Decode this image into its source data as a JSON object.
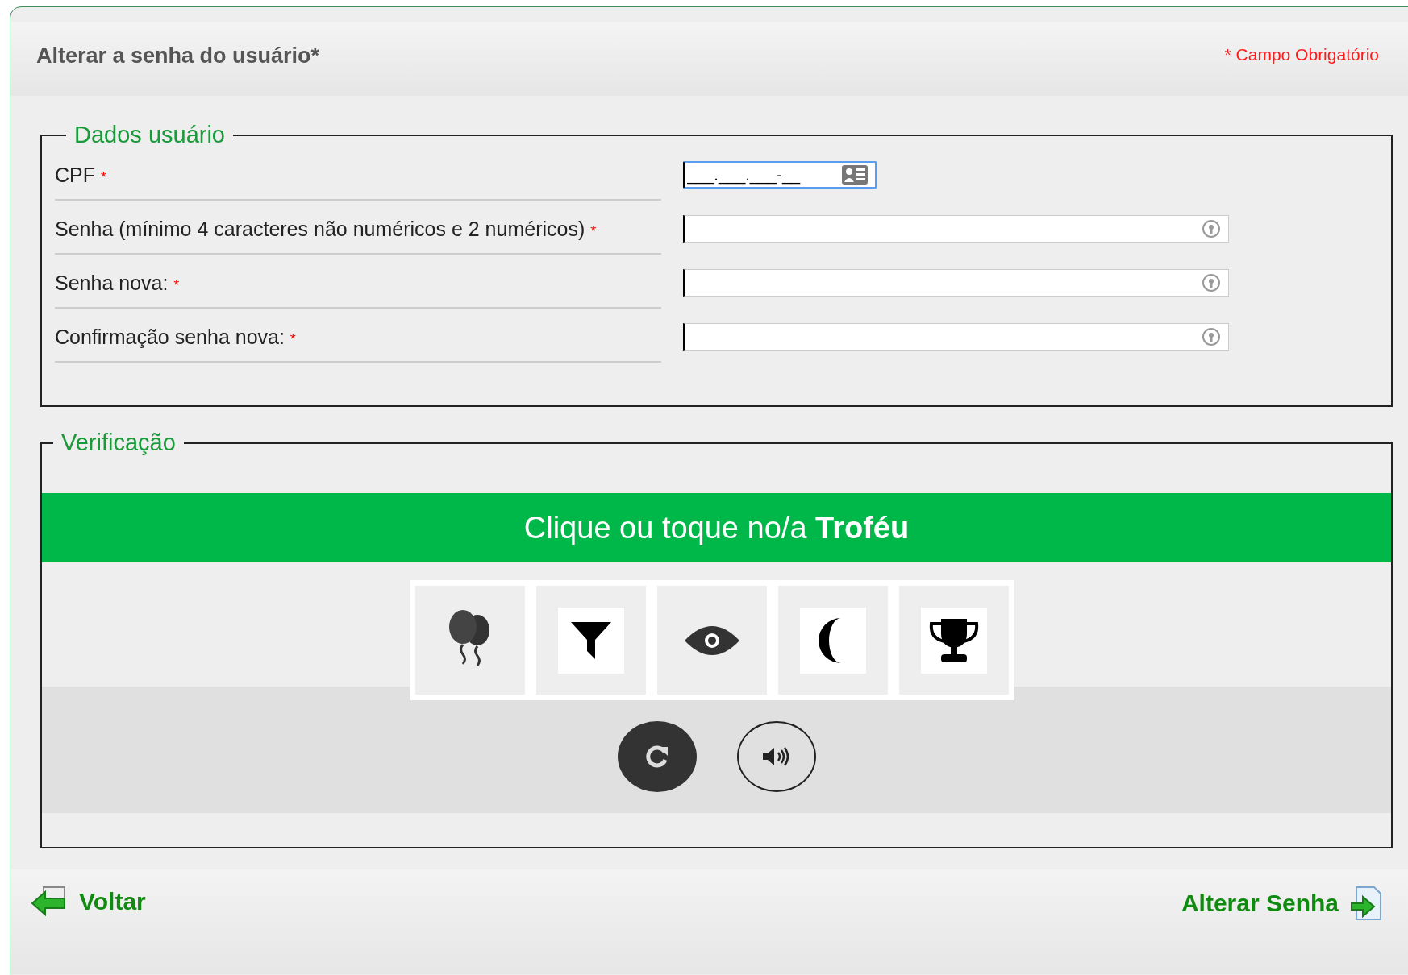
{
  "header": {
    "title": "Alterar a senha do usuário*",
    "required_note": "* Campo Obrigatório"
  },
  "user_data": {
    "legend": "Dados usuário",
    "fields": [
      {
        "kind": "cpf",
        "label": "CPF",
        "required_mark": "*",
        "placeholder": "___.___.___-__"
      },
      {
        "kind": "password",
        "label": "Senha (mínimo 4 caracteres não numéricos e 2 numéricos)",
        "required_mark": "*"
      },
      {
        "kind": "password",
        "label": "Senha nova:",
        "required_mark": "*"
      },
      {
        "kind": "password",
        "label": "Confirmação senha nova:",
        "required_mark": "*"
      }
    ]
  },
  "verification": {
    "legend": "Verificação",
    "prompt": "Clique ou toque no/a **Troféu**",
    "options": [
      {
        "kind": "balloons"
      },
      {
        "kind": "filter"
      },
      {
        "kind": "eye"
      },
      {
        "kind": "moon"
      },
      {
        "kind": "trophy"
      }
    ]
  },
  "footer": {
    "back": "Voltar",
    "submit": "Alterar Senha"
  }
}
